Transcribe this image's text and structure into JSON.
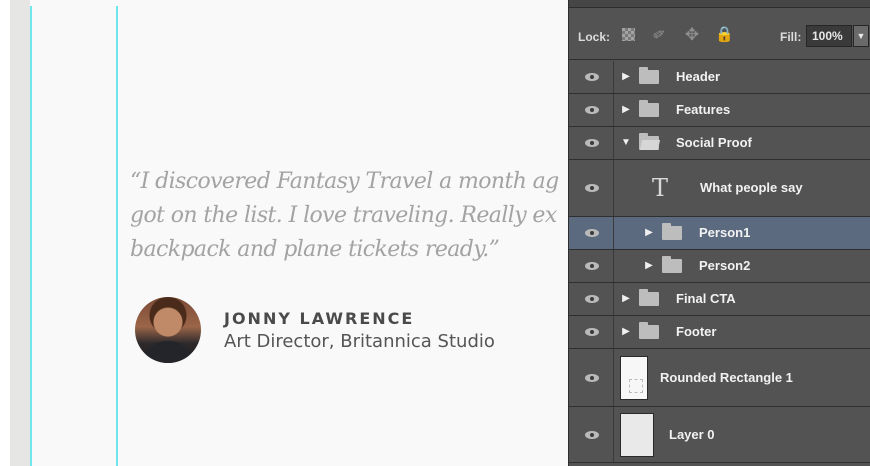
{
  "canvas": {
    "quote_lines": [
      "“I discovered Fantasy Travel a month ag",
      "got on the list. I love traveling. Really ex",
      "backpack and plane tickets ready.”"
    ],
    "person_name": "JONNY LAWRENCE",
    "person_title": "Art Director, Britannica Studio",
    "guide_color": "#6fe6ee"
  },
  "layers_panel": {
    "lock_label": "Lock:",
    "lock_icons": [
      "lock-transparent-pixels-icon",
      "lock-image-pixels-icon",
      "lock-position-icon",
      "lock-all-icon"
    ],
    "fill_label": "Fill:",
    "fill_value": "100%",
    "selected_color": "#5c6a80",
    "layers": [
      {
        "name": "Header",
        "kind": "group",
        "expanded": false,
        "indent": 0
      },
      {
        "name": "Features",
        "kind": "group",
        "expanded": false,
        "indent": 0
      },
      {
        "name": "Social Proof",
        "kind": "group",
        "expanded": true,
        "indent": 0
      },
      {
        "name": "What people say",
        "kind": "text",
        "indent": 1
      },
      {
        "name": "Person1",
        "kind": "group",
        "expanded": false,
        "indent": 1,
        "selected": true
      },
      {
        "name": "Person2",
        "kind": "group",
        "expanded": false,
        "indent": 1
      },
      {
        "name": "Final CTA",
        "kind": "group",
        "expanded": false,
        "indent": 0
      },
      {
        "name": "Footer",
        "kind": "group",
        "expanded": false,
        "indent": 0
      },
      {
        "name": "Rounded Rectangle 1",
        "kind": "shape",
        "indent": 0
      },
      {
        "name": "Layer 0",
        "kind": "pixel",
        "indent": 0
      }
    ]
  }
}
